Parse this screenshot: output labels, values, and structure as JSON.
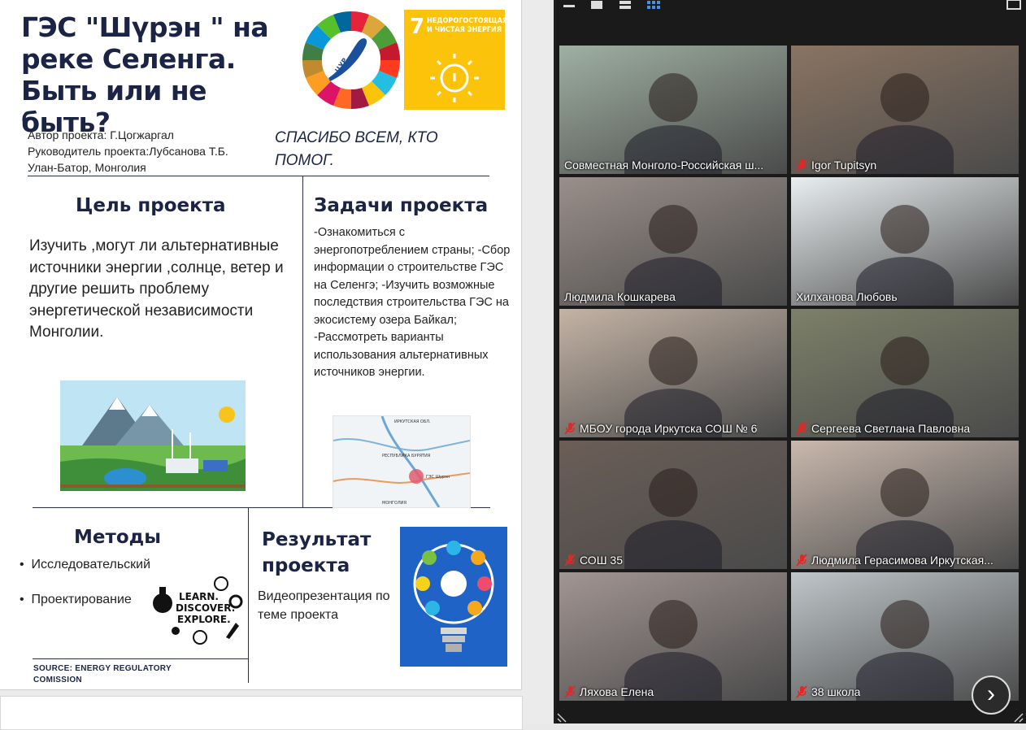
{
  "slide": {
    "title": "ГЭС \"Шүрэн \" на реке Селенга. Быть или не быть?",
    "sdg7_number": "7",
    "sdg7_text": "НЕДОРОГОСТОЯЩАЯ И ЧИСТАЯ ЭНЕРГИЯ",
    "wheel_text": "ЦУР НА БАЙКАЛЕ!",
    "author_lines": [
      "Автор проекта: Г.Цогжаргал",
      "Руководитель проекта:Лубсанова Т.Б.",
      "Улан-Батор, Монголия"
    ],
    "thanks": "СПАСИБО ВСЕМ, КТО ПОМОГ.",
    "goal_heading": "Цель проекта",
    "goal_text": "Изучить ,могут  ли  альтернативные источники энергии ,солнце, ветер и другие решить проблему энергетической независимости Монголии.",
    "tasks_heading": "Задачи проекта",
    "tasks_text": "-Ознакомиться с энергопотреблением страны; -Сбор информации о строительстве ГЭС на Селенгэ; -Изучить возможные последствия строительства ГЭС на экосистему озера Байкал; -Рассмотреть варианты использования альтернативных источников энергии.",
    "methods_heading": "Методы",
    "methods": [
      "Исследовательский",
      "Проектирование"
    ],
    "learn_text": [
      "LEARN.",
      "DISCOVER.",
      "EXPLORE."
    ],
    "result_heading": "Результат проекта",
    "result_text": "Видеопрезентация по теме проекта",
    "source": "SOURCE: ENERGY REGULATORY COMISSION",
    "map_labels": [
      "ИРКУТСКАЯ ОБЛ.",
      "РЕСПУБЛИКА БУРЯТИЯ",
      "ГЭС Шурэн",
      "МОНГОЛИЯ"
    ]
  },
  "zoom": {
    "participants": [
      {
        "name": "Совместная Монголо-Российская ш...",
        "muted": false,
        "active": true,
        "bg": "#9fb0a2"
      },
      {
        "name": "Igor Tupitsyn",
        "muted": true,
        "active": false,
        "bg": "#8a7462"
      },
      {
        "name": "Людмила Кошкарева",
        "muted": false,
        "active": false,
        "bg": "#9a8f8a"
      },
      {
        "name": "Хилханова Любовь",
        "muted": false,
        "active": false,
        "bg": "#e9eef0"
      },
      {
        "name": "МБОУ города Иркутска СОШ № 6",
        "muted": true,
        "active": false,
        "bg": "#c4b3a5"
      },
      {
        "name": "Сергеева Светлана Павловна",
        "muted": true,
        "active": false,
        "bg": "#7d8069"
      },
      {
        "name": "СОШ 35",
        "muted": true,
        "active": false,
        "bg": "#6b5e57"
      },
      {
        "name": "Людмила Герасимова Иркутская...",
        "muted": true,
        "active": false,
        "bg": "#c9b8ad"
      },
      {
        "name": "Ляхова Елена",
        "muted": true,
        "active": false,
        "bg": "#a29593"
      },
      {
        "name": "38 школа",
        "muted": true,
        "active": false,
        "bg": "#bfc6c9"
      }
    ],
    "next_label": "›"
  }
}
